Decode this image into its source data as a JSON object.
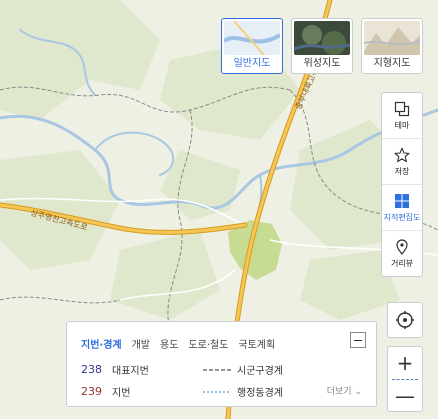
{
  "map_types": [
    {
      "label": "일반지도",
      "selected": true
    },
    {
      "label": "위성지도",
      "selected": false
    },
    {
      "label": "지형지도",
      "selected": false
    }
  ],
  "toolbar": {
    "items": [
      {
        "label": "테마",
        "icon": "layers-icon"
      },
      {
        "label": "저장",
        "icon": "star-icon"
      },
      {
        "label": "지적편집도",
        "icon": "cadastral-grid-icon",
        "active": true
      },
      {
        "label": "거리뷰",
        "icon": "street-view-icon"
      }
    ]
  },
  "map": {
    "road_labels": [
      "상주영천고속도로",
      "중부내륙고속도로"
    ],
    "colors": {
      "base": "#eef0e3",
      "terrain": "#dfe7cc",
      "river": "#a9c6e3",
      "highway": "#e7b53a",
      "urban": "#c7dc92",
      "boundary": "#8a8a8a"
    }
  },
  "zoom": {
    "in": "+",
    "out": "—"
  },
  "legend": {
    "tabs": [
      {
        "label": "지번·경계",
        "active": true
      },
      {
        "label": "개발"
      },
      {
        "label": "용도"
      },
      {
        "label": "도로·철도"
      },
      {
        "label": "국토계획"
      }
    ],
    "rows": [
      {
        "num": "238",
        "num_color": "#333399",
        "label": "대표지번",
        "line_label": "시군구경계"
      },
      {
        "num": "239",
        "num_color": "#993333",
        "label": "지번",
        "line_label": "행정동경계"
      }
    ],
    "more": "더보기 ⌄"
  }
}
